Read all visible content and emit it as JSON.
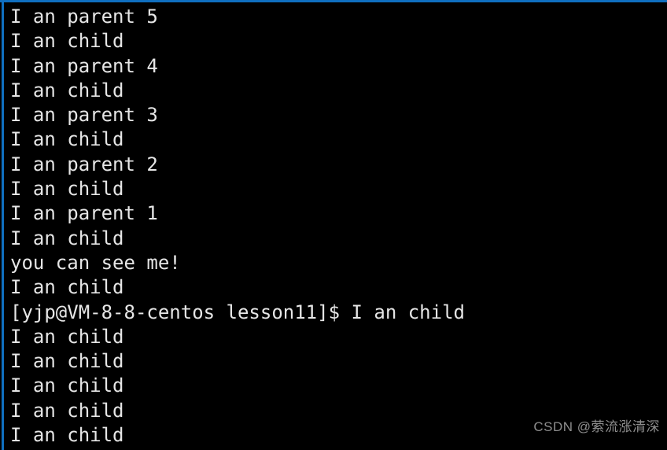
{
  "window": {
    "kind": "terminal-console",
    "background_color": "#000000",
    "text_color": "#e6e6e6",
    "accent_border_color": "#0f6fc0"
  },
  "terminal": {
    "lines": [
      "I an parent 5",
      "I an child",
      "I an parent 4",
      "I an child",
      "I an parent 3",
      "I an child",
      "I an parent 2",
      "I an child",
      "I an parent 1",
      "I an child",
      "you can see me!",
      "I an child",
      "[yjp@VM-8-8-centos lesson11]$ I an child",
      "I an child",
      "I an child",
      "I an child",
      "I an child",
      "I an child"
    ],
    "prompt": {
      "line_index": 12,
      "user": "yjp",
      "host": "VM-8-8-centos",
      "directory": "lesson11",
      "symbol": "$",
      "full": "[yjp@VM-8-8-centos lesson11]$",
      "trailing_output": "I an child"
    }
  },
  "watermark": {
    "text": "CSDN @萦流涨清深",
    "color": "#8e8e8e"
  }
}
